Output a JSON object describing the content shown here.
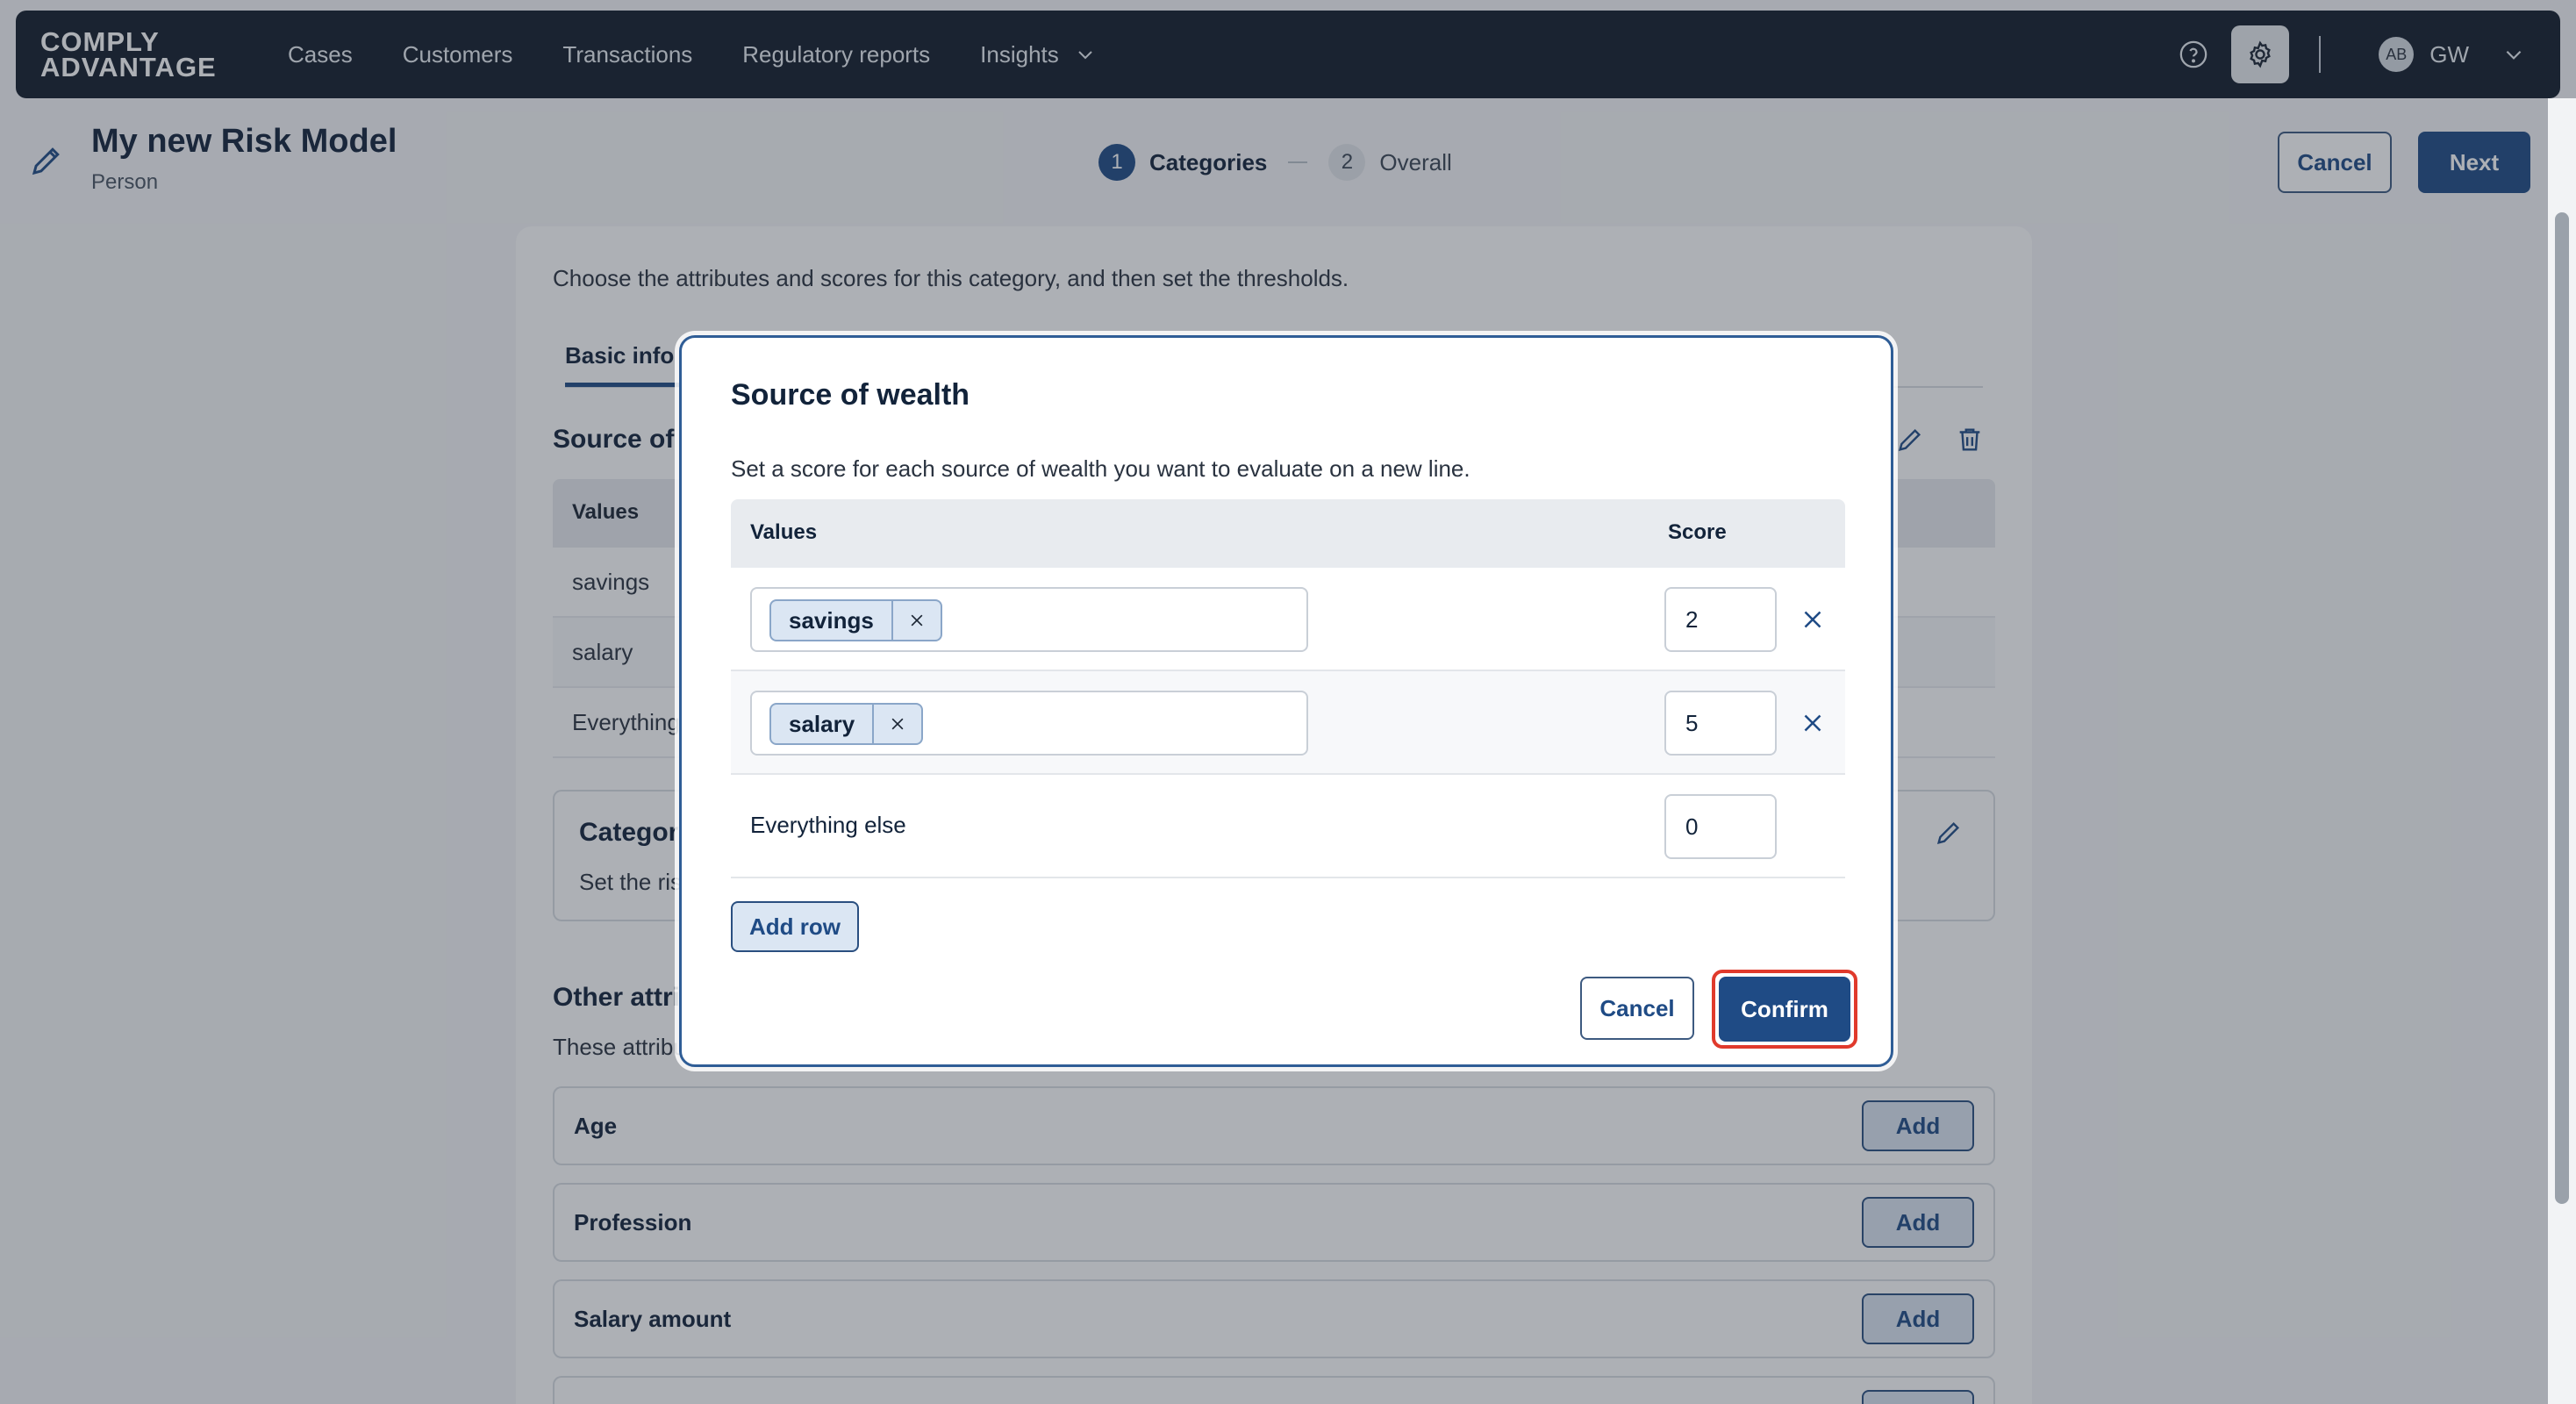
{
  "nav": {
    "logo_line1": "COMPLY",
    "logo_line2": "ADVANTAGE",
    "links": [
      "Cases",
      "Customers",
      "Transactions",
      "Regulatory reports",
      "Insights"
    ],
    "avatar_initials": "AB",
    "user_initials": "GW",
    "icons": [
      "help-circle-icon",
      "gear-icon",
      "chevron-down-icon"
    ]
  },
  "header": {
    "title": "My new Risk Model",
    "subtitle": "Person",
    "steps": [
      {
        "num": "1",
        "label": "Categories",
        "active": true
      },
      {
        "num": "2",
        "label": "Overall",
        "active": false
      }
    ],
    "cancel_label": "Cancel",
    "next_label": "Next"
  },
  "background": {
    "intro": "Choose the attributes and scores for this category, and then set the thresholds.",
    "tab_label": "Basic info",
    "section_title": "Source of wealth",
    "table_header": "Values",
    "rows": [
      "savings",
      "salary",
      "Everything else"
    ],
    "category_title": "Category",
    "category_desc": "Set the risk",
    "other_title": "Other attributes",
    "other_desc": "These attributes",
    "attributes": [
      "Age",
      "Profession",
      "Salary amount"
    ],
    "add_label": "Add"
  },
  "modal": {
    "title": "Source of wealth",
    "description": "Set a score for each source of wealth you want to evaluate on a new line.",
    "col_values": "Values",
    "col_score": "Score",
    "rows": [
      {
        "chip": "savings",
        "score": "2"
      },
      {
        "chip": "salary",
        "score": "5"
      }
    ],
    "else_label": "Everything else",
    "else_score": "0",
    "add_row_label": "Add row",
    "cancel_label": "Cancel",
    "confirm_label": "Confirm"
  },
  "colors": {
    "nav_bg": "#121c2b",
    "primary": "#1f4b85",
    "highlight": "#e03a2c"
  }
}
